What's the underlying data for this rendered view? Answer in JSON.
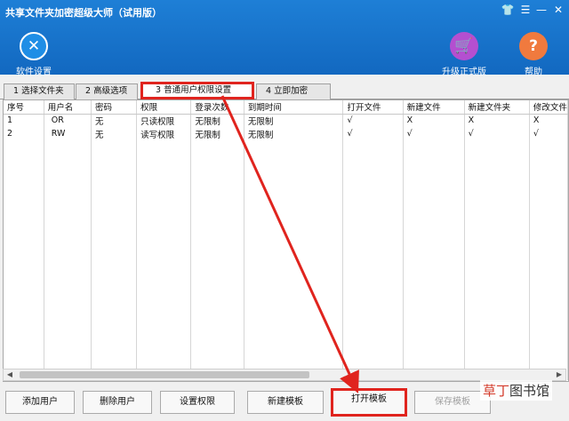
{
  "window": {
    "title": "共享文件夹加密超级大师（试用版）",
    "controls": [
      "shirt-icon",
      "menu-icon",
      "minimize-icon",
      "close-icon"
    ]
  },
  "toolbar": {
    "settings": {
      "label": "软件设置",
      "icon": "wrench-icon",
      "color": "#1f8ee6"
    },
    "upgrade": {
      "label": "升级正式版",
      "icon": "cart-icon",
      "color": "#b44fd0"
    },
    "help": {
      "label": "帮助",
      "icon": "question-icon",
      "color": "#f07a3e"
    }
  },
  "tabs": [
    "1 选择文件夹",
    "2 高级选项",
    "3 普通用户权限设置",
    "4 立即加密"
  ],
  "active_tab": 2,
  "table": {
    "columns": [
      "序号",
      "用户名",
      "密码",
      "权限",
      "登录次数",
      "到期时间",
      "打开文件",
      "新建文件",
      "新建文件夹",
      "修改文件"
    ],
    "rows": [
      [
        "1",
        "OR",
        "无",
        "只读权限",
        "无限制",
        "无限制",
        "√",
        "X",
        "X",
        "X"
      ],
      [
        "2",
        "RW",
        "无",
        "读写权限",
        "无限制",
        "无限制",
        "√",
        "√",
        "√",
        "√"
      ]
    ]
  },
  "buttons": {
    "add_user": "添加用户",
    "delete_user": "删除用户",
    "set_permission": "设置权限",
    "new_template": "新建模板",
    "open_template": "打开模板",
    "save_template": "保存模板"
  },
  "watermark": {
    "brand": "草丁",
    "suffix": "图书馆"
  },
  "colors": {
    "titlebar": "#1268c0",
    "highlight": "#e0241e"
  }
}
